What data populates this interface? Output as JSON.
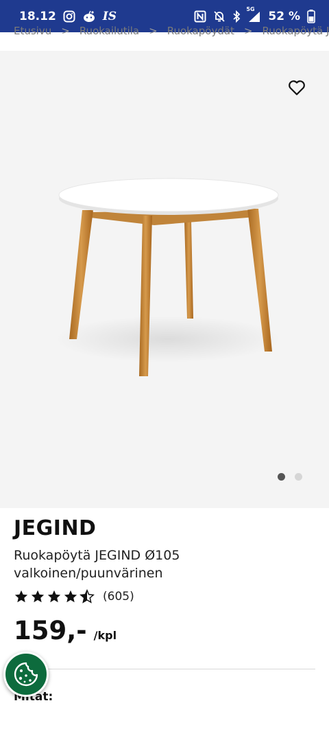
{
  "status_bar": {
    "time": "18.12",
    "battery": "52 %",
    "network": "5G",
    "left_icons": [
      "instagram-icon",
      "reddit-icon",
      "is-app-icon"
    ],
    "right_icons": [
      "nfc-icon",
      "mute-icon",
      "bluetooth-icon",
      "signal-icon",
      "battery-icon"
    ],
    "is_app_label": "IS"
  },
  "breadcrumb": {
    "items": [
      "Etusivu",
      "Ruokailutila",
      "Ruokapöydät",
      "Ruokapöytä JEG"
    ],
    "separator": ">"
  },
  "gallery": {
    "dot_count": 2,
    "active_index": 0
  },
  "product": {
    "brand": "JEGIND",
    "description": "Ruokapöytä JEGIND Ø105 valkoinen/puunvärinen",
    "rating": 4.5,
    "rating_count": "(605)",
    "price": "159,-",
    "unit": "/kpl"
  },
  "sections": {
    "dimensions_title": "Mitat:"
  },
  "colors": {
    "status_bar": "#1f3a8f",
    "cookie_button": "#0d6b3d",
    "image_background": "#f4f4f4"
  }
}
